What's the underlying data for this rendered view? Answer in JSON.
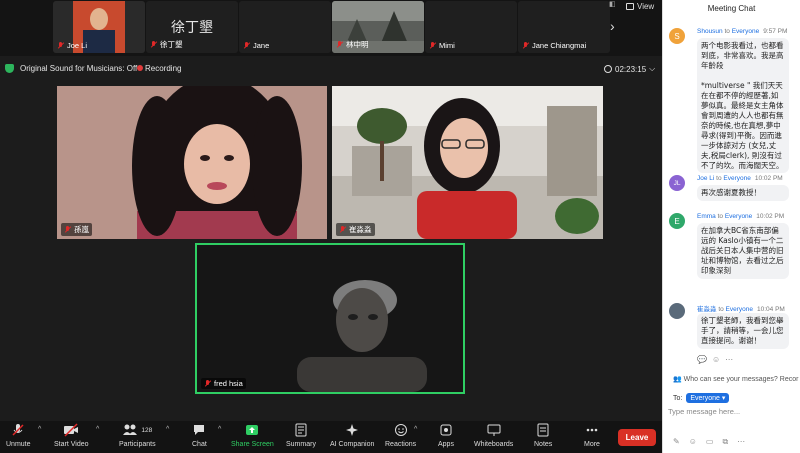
{
  "thumbnails": [
    {
      "name": "Joe Li",
      "big": ""
    },
    {
      "name": "徐丁墾",
      "big": "徐丁墾"
    },
    {
      "name": "Jane",
      "big": ""
    },
    {
      "name": "林中明",
      "big": ""
    },
    {
      "name": "Mimi",
      "big": ""
    },
    {
      "name": "Jane Chiangmai",
      "big": ""
    }
  ],
  "view_label": "View",
  "status": {
    "sound": "Original Sound for Musicians: Off",
    "recording": "Recording",
    "timer": "02:23:15"
  },
  "tiles": [
    {
      "name": "孫嵐"
    },
    {
      "name": "崔淼淼"
    },
    {
      "name": "fred hsia"
    }
  ],
  "toolbar": {
    "unmute": "Unmute",
    "start_video": "Start Video",
    "participants": "Participants",
    "participants_count": "128",
    "chat": "Chat",
    "share_screen": "Share Screen",
    "summary": "Summary",
    "ai_companion": "AI Companion",
    "reactions": "Reactions",
    "apps": "Apps",
    "whiteboards": "Whiteboards",
    "notes": "Notes",
    "more": "More",
    "leave": "Leave"
  },
  "chat": {
    "title": "Meeting Chat",
    "messages": [
      {
        "initial": "S",
        "sender": "Shousun",
        "to_word": "to",
        "recipient": "Everyone",
        "time": "9:57 PM",
        "text": "两个电影我看过，也都看到底，非常喜欢。我是高年齡段\n\n*multiverse \" 我们天天在在都不停的經歷著,如夢似真。最終是女主角体會到周遭的人人也都有無奈的時候,也在真想,夢中尋求(得到)平衡。因而進一步体諒对方 (女兒,丈夫,税局clerk), 則沒有过不了的坎。而海闊天空。"
      },
      {
        "initial": "JL",
        "sender": "Joe Li",
        "to_word": "to",
        "recipient": "Everyone",
        "time": "10:02 PM",
        "text": "再次感谢夏教授！"
      },
      {
        "initial": "E",
        "sender": "Emma",
        "to_word": "to",
        "recipient": "Everyone",
        "time": "10:02 PM",
        "text": "在加拿大BC省东南部偏远的 Kaslo小镇有一个二战后关日本人集中营的旧址和博物馆，去看过之后印象深刻"
      },
      {
        "initial": "",
        "sender": "崔淼淼",
        "to_word": "to",
        "recipient": "Everyone",
        "time": "10:04 PM",
        "text": "徐丁墾老師，我看到您舉手了，請稍等，一会儿您直接提问。谢谢！"
      }
    ],
    "privacy": "Who can see your messages? Recor",
    "to_label": "To:",
    "recipient_selected": "Everyone",
    "input_placeholder": "Type message here..."
  },
  "colors": {
    "leave": "#d93025",
    "share_screen": "#2fce63",
    "active_speaker_border": "#2fce63",
    "accent_blue": "#1e6fe0",
    "avatar_S": "#f0a23a",
    "avatar_JL": "#8a63d2",
    "avatar_E": "#2fa86a"
  }
}
